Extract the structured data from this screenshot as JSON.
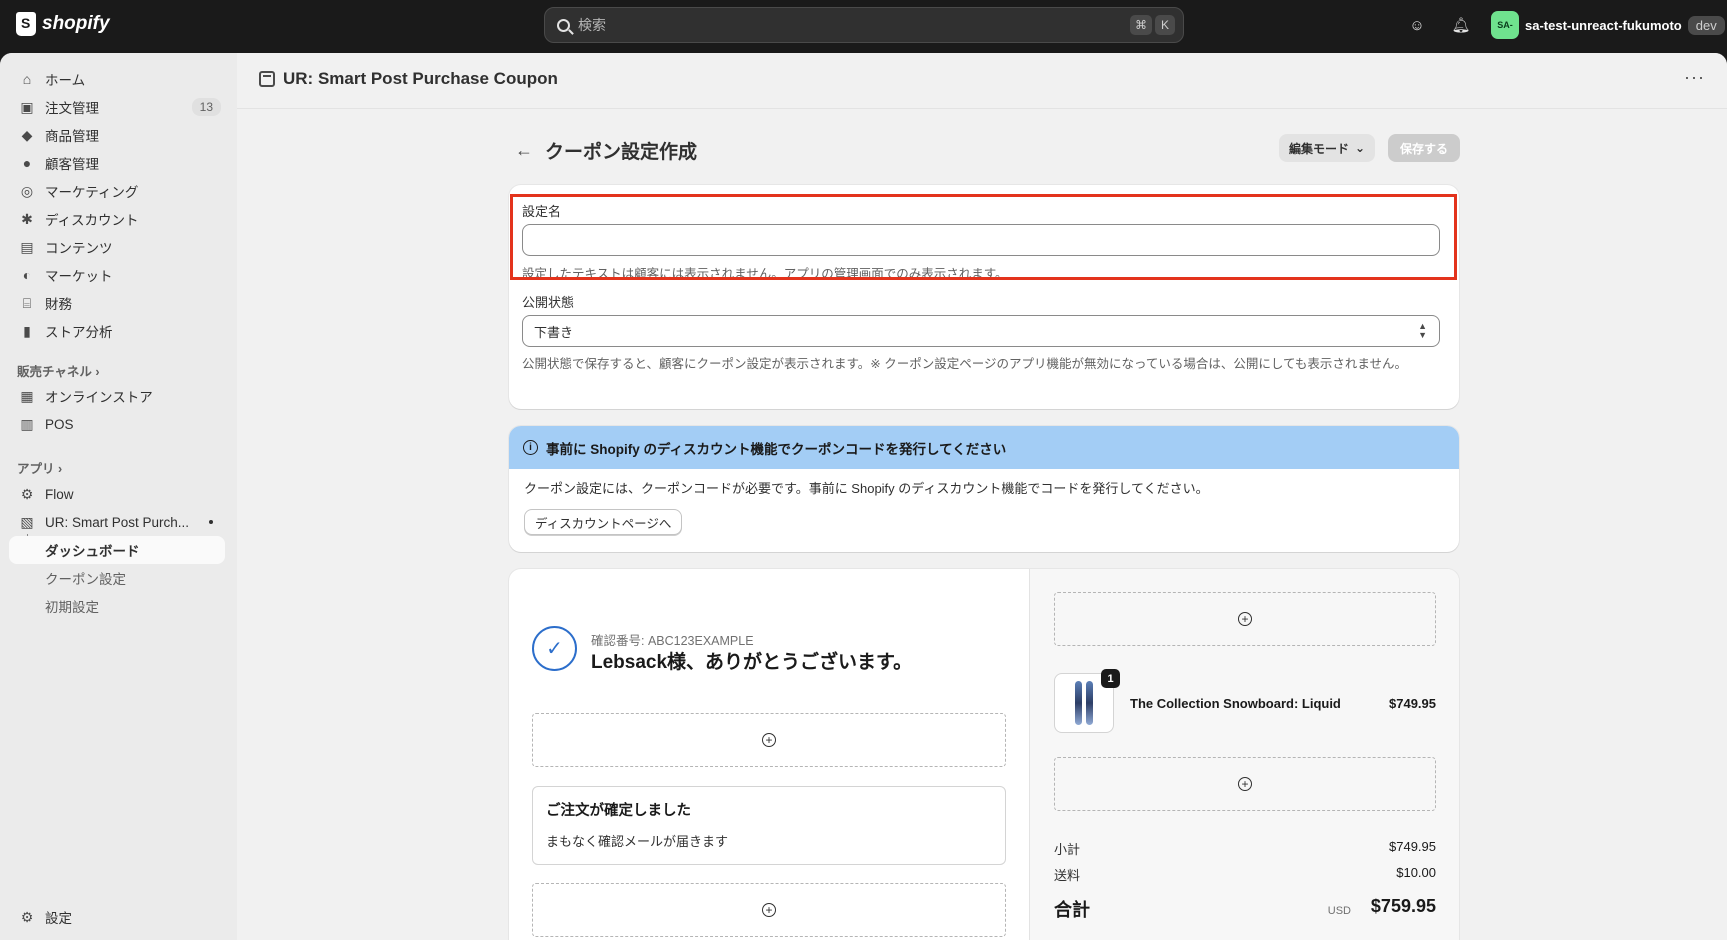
{
  "topbar": {
    "brand": "shopify",
    "search_placeholder": "検索",
    "shortcut_1": "⌘",
    "shortcut_2": "K",
    "store_avatar": "SA-",
    "store_name": "sa-test-unreact-fukumoto",
    "store_badge": "dev"
  },
  "sidebar": {
    "items": [
      {
        "label": "ホーム",
        "icon": "home-icon"
      },
      {
        "label": "注文管理",
        "icon": "inbox-icon",
        "badge": "13"
      },
      {
        "label": "商品管理",
        "icon": "tag-icon"
      },
      {
        "label": "顧客管理",
        "icon": "person-icon"
      },
      {
        "label": "マーケティング",
        "icon": "target-icon"
      },
      {
        "label": "ディスカウント",
        "icon": "discount-icon"
      },
      {
        "label": "コンテンツ",
        "icon": "content-icon"
      },
      {
        "label": "マーケット",
        "icon": "globe-icon"
      },
      {
        "label": "財務",
        "icon": "bank-icon"
      },
      {
        "label": "ストア分析",
        "icon": "chart-icon"
      }
    ],
    "sales_channels_label": "販売チャネル",
    "channels": [
      {
        "label": "オンラインストア",
        "icon": "store-icon"
      },
      {
        "label": "POS",
        "icon": "pos-icon"
      }
    ],
    "apps_label": "アプリ",
    "apps": [
      {
        "label": "Flow",
        "icon": "flow-icon"
      },
      {
        "label": "UR: Smart Post Purch...",
        "icon": "app-icon"
      }
    ],
    "app_sub": [
      "ダッシュボード",
      "クーポン設定",
      "初期設定"
    ],
    "settings_label": "設定"
  },
  "header": {
    "app_title": "UR: Smart Post Purchase Coupon",
    "more": "···"
  },
  "page": {
    "title": "クーポン設定作成",
    "mode_button": "編集モード",
    "save_button": "保存する"
  },
  "form": {
    "name_label": "設定名",
    "name_value": "",
    "name_help": "設定したテキストは顧客には表示されません。アプリの管理画面でのみ表示されます。",
    "status_label": "公開状態",
    "status_value": "下書き",
    "status_help": "公開状態で保存すると、顧客にクーポン設定が表示されます。※ クーポン設定ページのアプリ機能が無効になっている場合は、公開にしても表示されません。"
  },
  "banner": {
    "title": "事前に Shopify のディスカウント機能でクーポンコードを発行してください",
    "body": "クーポン設定には、クーポンコードが必要です。事前に Shopify のディスカウント機能でコードを発行してください。",
    "button": "ディスカウントページへ"
  },
  "preview": {
    "confirmation": "確認番号: ABC123EXAMPLE",
    "thanks": "Lebsack様、ありがとうございます。",
    "order_title": "ご注文が確定しました",
    "order_sub": "まもなく確認メールが届きます",
    "product_qty": "1",
    "product_name": "The Collection Snowboard: Liquid",
    "product_price": "$749.95",
    "subtotal_label": "小計",
    "subtotal_value": "$749.95",
    "shipping_label": "送料",
    "shipping_value": "$10.00",
    "total_label": "合計",
    "currency": "USD",
    "total_value": "$759.95"
  }
}
